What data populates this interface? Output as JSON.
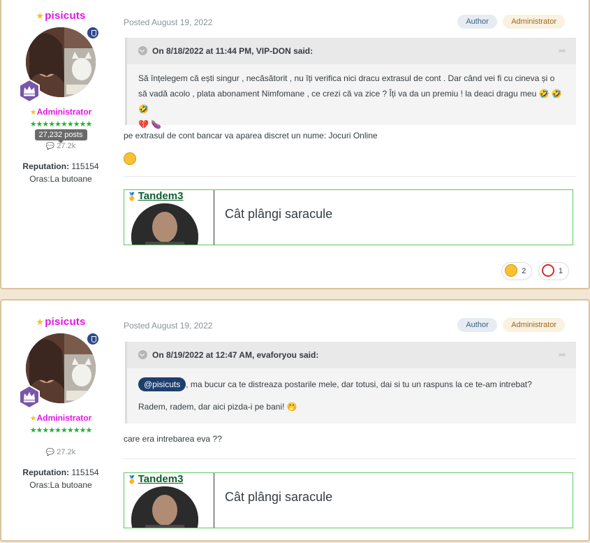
{
  "posts": [
    {
      "username": "pisicuts",
      "role": "Administrator",
      "stars": "★★★★★★★★★★",
      "posts_tooltip": "27,232 posts",
      "post_count": "27.2k",
      "reputation_label": "Reputation:",
      "reputation_value": "115154",
      "oras": "Oras:La butoane",
      "posted": "Posted August 19, 2022",
      "tag_author": "Author",
      "tag_admin": "Administrator",
      "quote_header": "On 8/18/2022 at 11:44 PM, VIP-DON said:",
      "quote_text": "Să înțelegem că ești singur , necăsătorit , nu îți verifica nici dracu extrasul de cont . Dar când vei fi cu cineva și o să vadă acolo , plata abonament Nimfomane , ce crezi că va zice ? Îți va da un premiu ! la deaci dragu meu 🤣 🤣 🤣",
      "quote_text2": "💔 🍆",
      "body_text": "pe extrasul de cont bancar va aparea discret un nume: Jocuri Online",
      "sig_name": "Tandem3",
      "sig_text": "Cât plângi saracule",
      "reaction_laugh": "2",
      "reaction_heart": "1"
    },
    {
      "username": "pisicuts",
      "role": "Administrator",
      "stars": "★★★★★★★★★★",
      "post_count": "27.2k",
      "reputation_label": "Reputation:",
      "reputation_value": "115154",
      "oras": "Oras:La butoane",
      "posted": "Posted August 19, 2022",
      "tag_author": "Author",
      "tag_admin": "Administrator",
      "quote_header": "On 8/19/2022 at 12:47 AM, evaforyou said:",
      "mention": "@pisicuts",
      "quote_text": ", ma bucur ca te distreaza postarile mele, dar totusi, dai si tu un raspuns la ce te-am intrebat?",
      "quote_text2": "Radem, radem, dar aici pizda-i pe bani! 🤭",
      "body_text": "care era intrebarea eva ??",
      "sig_name": "Tandem3",
      "sig_text": "Cât plângi saracule"
    }
  ],
  "colors": {
    "username": "#e316e3",
    "stars": "#27b33a",
    "sig_border": "#59c95c"
  },
  "icons": [
    "star-icon",
    "shield-badge-icon",
    "rank-crown-icon",
    "comment-bubble-icon",
    "quote-collapse-icon",
    "share-icon",
    "smile-emoji-icon",
    "medal-icon",
    "laugh-reaction-icon",
    "heart-reaction-icon"
  ]
}
